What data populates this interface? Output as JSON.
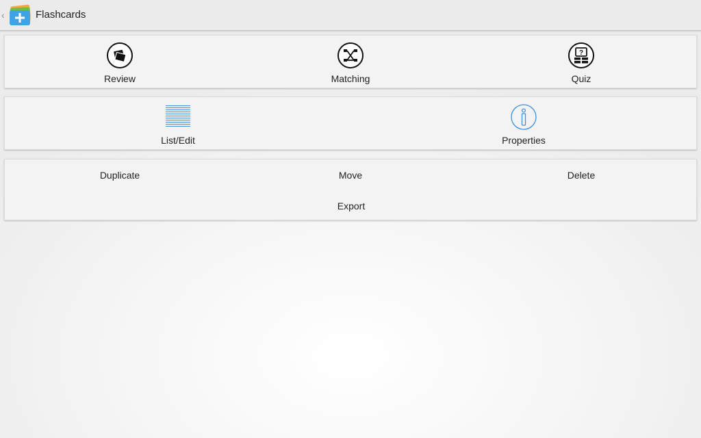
{
  "app": {
    "title": "Flashcards",
    "icon": "flashcards-app-icon"
  },
  "study_modes": [
    {
      "label": "Review",
      "icon": "cards-icon"
    },
    {
      "label": "Matching",
      "icon": "matching-icon"
    },
    {
      "label": "Quiz",
      "icon": "quiz-icon"
    }
  ],
  "deck_tools": [
    {
      "label": "List/Edit",
      "icon": "list-lines-icon"
    },
    {
      "label": "Properties",
      "icon": "info-icon"
    }
  ],
  "deck_actions": {
    "duplicate": "Duplicate",
    "move": "Move",
    "delete": "Delete",
    "export": "Export"
  },
  "colors": {
    "accent_blue": "#3b8fe0",
    "action_bar": "#ebebeb",
    "card_bg": "#f3f3f3"
  }
}
